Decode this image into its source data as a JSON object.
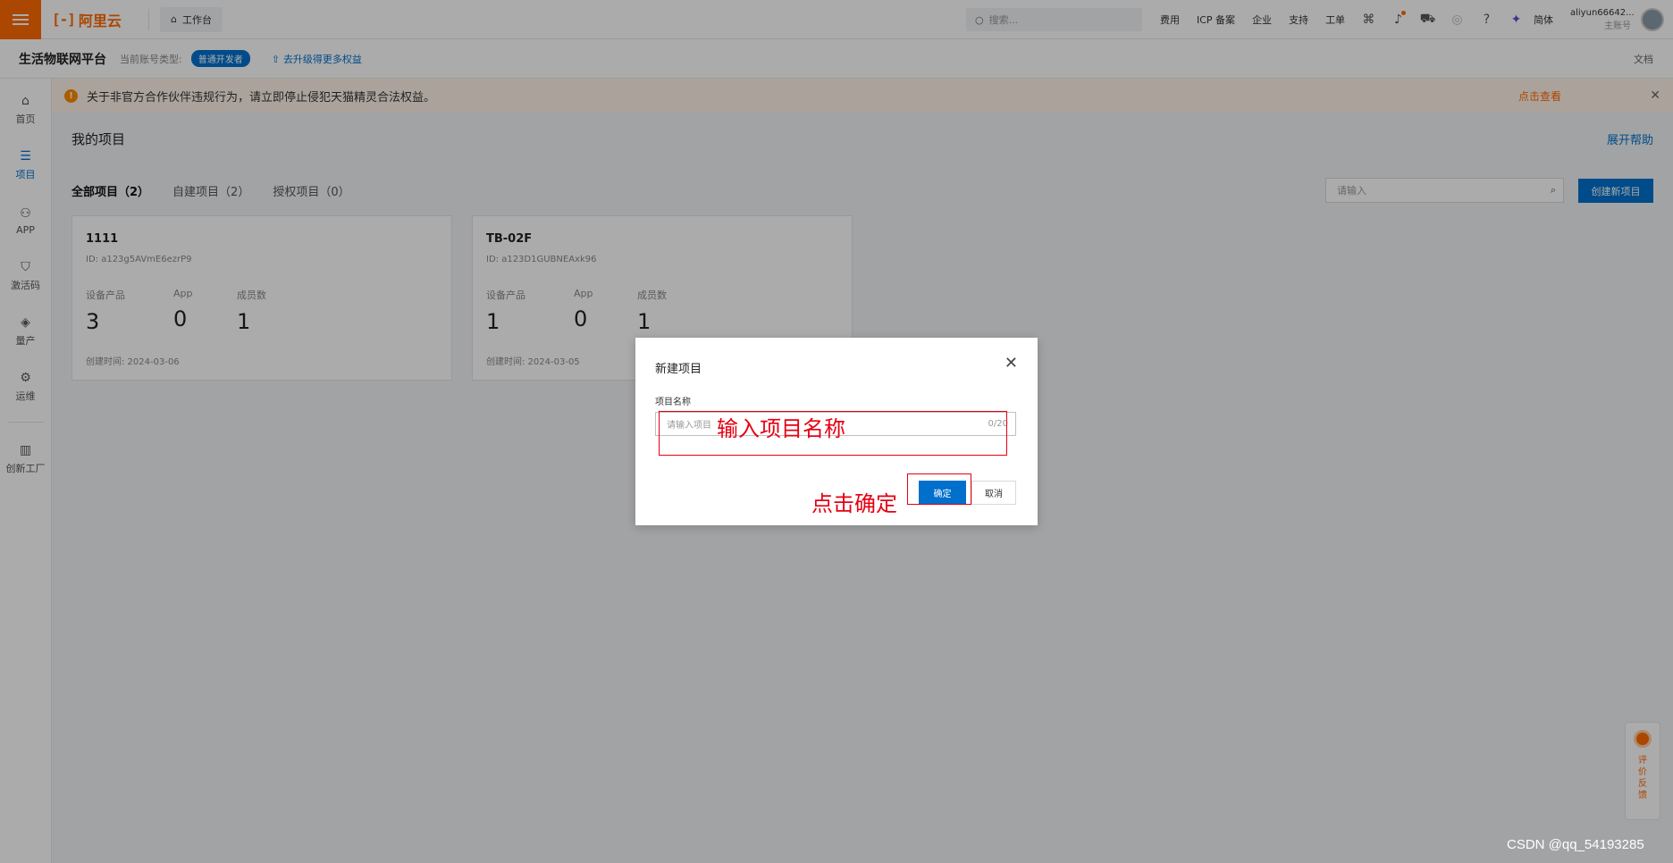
{
  "topbar": {
    "logo_text": "阿里云",
    "logo_mark": "[-]",
    "workbench": "工作台",
    "search_placeholder": "搜索...",
    "links": [
      "费用",
      "ICP 备案",
      "企业",
      "支持",
      "工单"
    ],
    "language": "简体",
    "username": "aliyun66642...",
    "account_role": "主账号"
  },
  "subheader": {
    "platform": "生活物联网平台",
    "account_type_label": "当前账号类型:",
    "account_type": "普通开发者",
    "upgrade": "去升级得更多权益",
    "docs": "文档"
  },
  "sidenav": {
    "items": [
      {
        "label": "首页",
        "icon": "home-icon"
      },
      {
        "label": "项目",
        "icon": "project-icon"
      },
      {
        "label": "APP",
        "icon": "app-icon"
      },
      {
        "label": "激活码",
        "icon": "activation-icon"
      },
      {
        "label": "量产",
        "icon": "production-icon"
      },
      {
        "label": "运维",
        "icon": "ops-icon"
      }
    ],
    "extra": {
      "label": "创新工厂",
      "icon": "factory-icon"
    }
  },
  "alert": {
    "text": "关于非官方合作伙伴违规行为，请立即停止侵犯天猫精灵合法权益。",
    "action": "点击查看"
  },
  "main": {
    "title": "我的项目",
    "help": "展开帮助",
    "tabs": [
      "全部项目（2）",
      "自建项目（2）",
      "授权项目（0）"
    ],
    "search_placeholder": "请输入",
    "create_button": "创建新项目",
    "stat_labels": [
      "设备产品",
      "App",
      "成员数"
    ],
    "projects": [
      {
        "name": "1111",
        "id": "ID: a123g5AVmE6ezrP9",
        "stats": [
          "3",
          "0",
          "1"
        ],
        "created": "创建时间: 2024-03-06"
      },
      {
        "name": "TB-02F",
        "id": "ID: a123D1GUBNEAxk96",
        "stats": [
          "1",
          "0",
          "1"
        ],
        "created": "创建时间: 2024-03-05"
      }
    ]
  },
  "modal": {
    "title": "新建项目",
    "field_label": "项目名称",
    "input_placeholder": "请输入项目",
    "counter": "0/20",
    "confirm": "确定",
    "cancel": "取消"
  },
  "annotations": {
    "input_hint": "输入项目名称",
    "confirm_hint": "点击确定",
    "color": "#e60012"
  },
  "feedback": {
    "label": "评价反馈"
  },
  "watermark": "CSDN @qq_54193285",
  "colors": {
    "brand": "#ff6a00",
    "primary": "#0070cc"
  }
}
